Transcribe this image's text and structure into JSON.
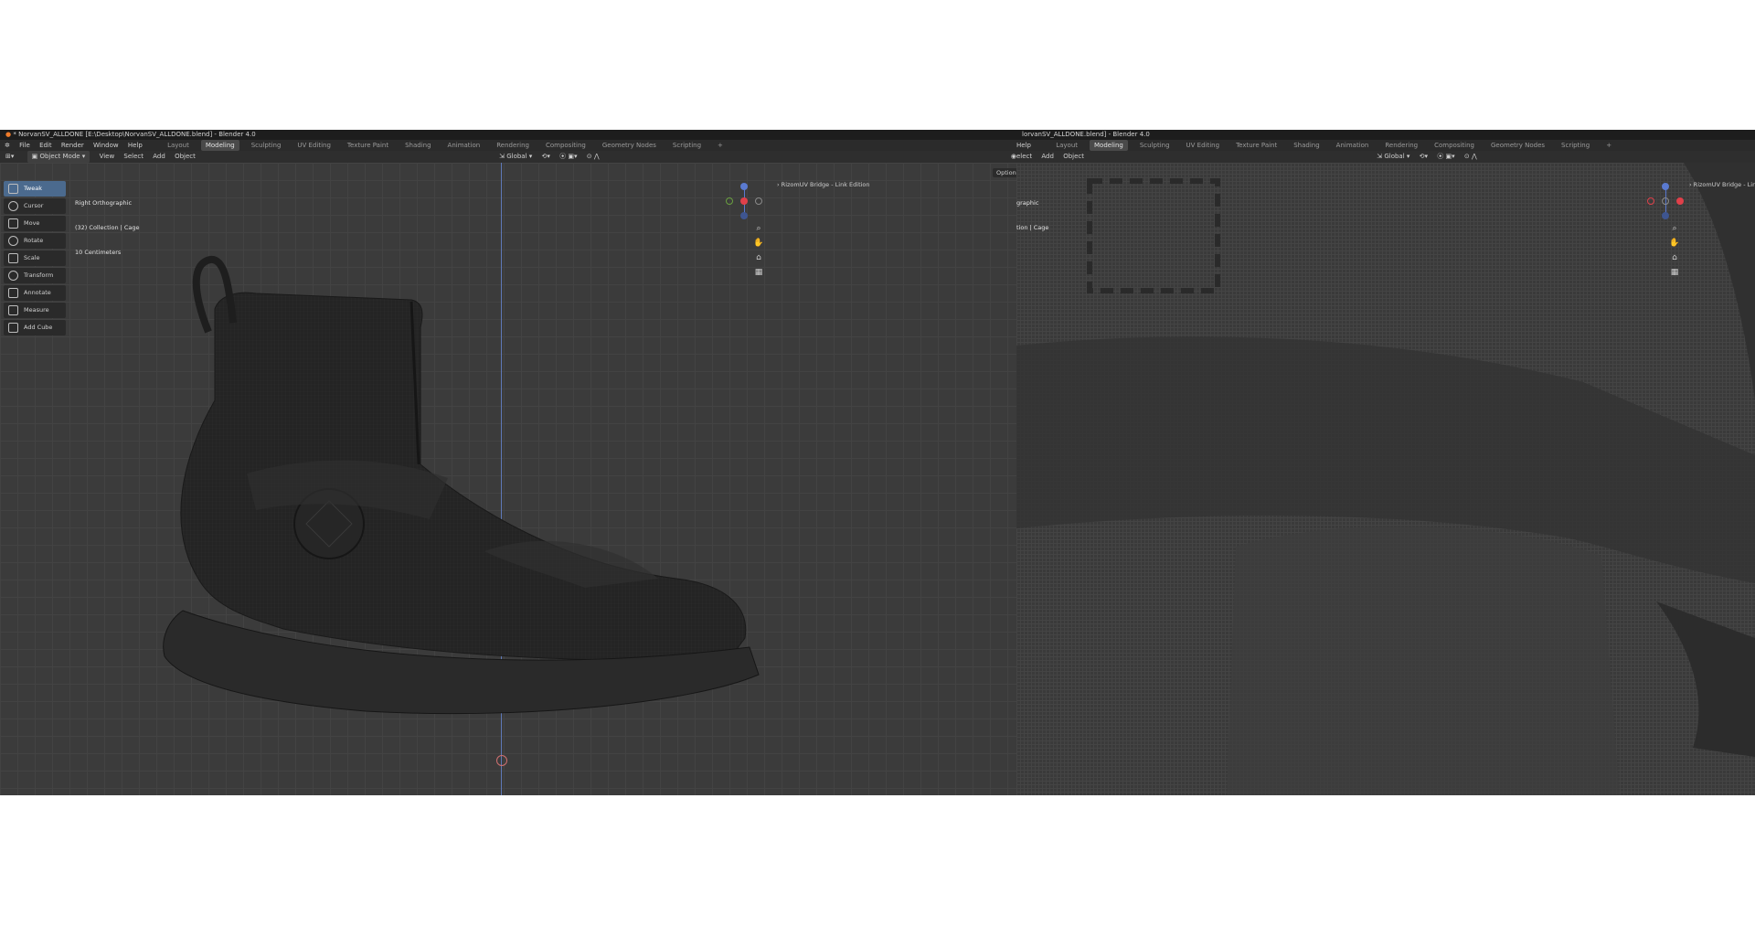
{
  "left": {
    "window_title": "* NorvanSV_ALLDONE [E:\\Desktop\\NorvanSV_ALLDONE.blend] - Blender 4.0",
    "menu": [
      "File",
      "Edit",
      "Render",
      "Window",
      "Help"
    ],
    "workspaces": [
      "Layout",
      "Modeling",
      "Sculpting",
      "UV Editing",
      "Texture Paint",
      "Shading",
      "Animation",
      "Rendering",
      "Compositing",
      "Geometry Nodes",
      "Scripting",
      "+"
    ],
    "active_workspace": "Modeling",
    "header": {
      "mode": "Object Mode",
      "items": [
        "View",
        "Select",
        "Add",
        "Object"
      ],
      "transform_orientation": "Global"
    },
    "viewport_info": {
      "view_name": "Right Orthographic",
      "collection": "(32) Collection | Cage",
      "scale": "10 Centimeters"
    },
    "addon_label": "RizomUV Bridge - Link Edition",
    "options_label": "Options",
    "tools": [
      "Tweak",
      "Cursor",
      "Move",
      "Rotate",
      "Scale",
      "Transform",
      "Annotate",
      "Measure",
      "Add Cube"
    ],
    "active_tool": "Tweak"
  },
  "right": {
    "window_title": "lorvanSV_ALLDONE.blend] - Blender 4.0",
    "menu": [
      "Help"
    ],
    "workspaces": [
      "Layout",
      "Modeling",
      "Sculpting",
      "UV Editing",
      "Texture Paint",
      "Shading",
      "Animation",
      "Rendering",
      "Compositing",
      "Geometry Nodes",
      "Scripting",
      "+"
    ],
    "active_workspace": "Modeling",
    "header_items": [
      "elect",
      "Add",
      "Object"
    ],
    "transform_orientation": "Global",
    "viewport_info": {
      "view_name": "graphic",
      "collection": "tion | Cage"
    },
    "addon_label": "RizomUV Bridge - Link E"
  },
  "colors": {
    "active_tool": "#4b6a8e",
    "gizmo_x": "#e0404a",
    "gizmo_y": "#6aa040",
    "gizmo_z": "#5a7ad0"
  }
}
